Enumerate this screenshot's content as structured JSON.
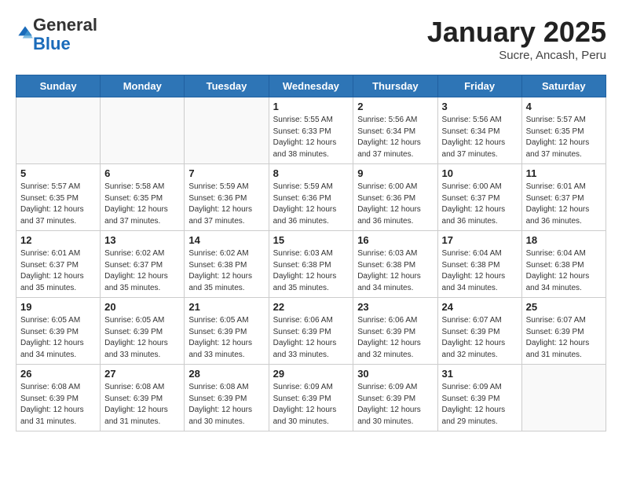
{
  "header": {
    "logo_general": "General",
    "logo_blue": "Blue",
    "month_title": "January 2025",
    "subtitle": "Sucre, Ancash, Peru"
  },
  "days_of_week": [
    "Sunday",
    "Monday",
    "Tuesday",
    "Wednesday",
    "Thursday",
    "Friday",
    "Saturday"
  ],
  "weeks": [
    [
      {
        "day": "",
        "info": ""
      },
      {
        "day": "",
        "info": ""
      },
      {
        "day": "",
        "info": ""
      },
      {
        "day": "1",
        "info": "Sunrise: 5:55 AM\nSunset: 6:33 PM\nDaylight: 12 hours\nand 38 minutes."
      },
      {
        "day": "2",
        "info": "Sunrise: 5:56 AM\nSunset: 6:34 PM\nDaylight: 12 hours\nand 37 minutes."
      },
      {
        "day": "3",
        "info": "Sunrise: 5:56 AM\nSunset: 6:34 PM\nDaylight: 12 hours\nand 37 minutes."
      },
      {
        "day": "4",
        "info": "Sunrise: 5:57 AM\nSunset: 6:35 PM\nDaylight: 12 hours\nand 37 minutes."
      }
    ],
    [
      {
        "day": "5",
        "info": "Sunrise: 5:57 AM\nSunset: 6:35 PM\nDaylight: 12 hours\nand 37 minutes."
      },
      {
        "day": "6",
        "info": "Sunrise: 5:58 AM\nSunset: 6:35 PM\nDaylight: 12 hours\nand 37 minutes."
      },
      {
        "day": "7",
        "info": "Sunrise: 5:59 AM\nSunset: 6:36 PM\nDaylight: 12 hours\nand 37 minutes."
      },
      {
        "day": "8",
        "info": "Sunrise: 5:59 AM\nSunset: 6:36 PM\nDaylight: 12 hours\nand 36 minutes."
      },
      {
        "day": "9",
        "info": "Sunrise: 6:00 AM\nSunset: 6:36 PM\nDaylight: 12 hours\nand 36 minutes."
      },
      {
        "day": "10",
        "info": "Sunrise: 6:00 AM\nSunset: 6:37 PM\nDaylight: 12 hours\nand 36 minutes."
      },
      {
        "day": "11",
        "info": "Sunrise: 6:01 AM\nSunset: 6:37 PM\nDaylight: 12 hours\nand 36 minutes."
      }
    ],
    [
      {
        "day": "12",
        "info": "Sunrise: 6:01 AM\nSunset: 6:37 PM\nDaylight: 12 hours\nand 35 minutes."
      },
      {
        "day": "13",
        "info": "Sunrise: 6:02 AM\nSunset: 6:37 PM\nDaylight: 12 hours\nand 35 minutes."
      },
      {
        "day": "14",
        "info": "Sunrise: 6:02 AM\nSunset: 6:38 PM\nDaylight: 12 hours\nand 35 minutes."
      },
      {
        "day": "15",
        "info": "Sunrise: 6:03 AM\nSunset: 6:38 PM\nDaylight: 12 hours\nand 35 minutes."
      },
      {
        "day": "16",
        "info": "Sunrise: 6:03 AM\nSunset: 6:38 PM\nDaylight: 12 hours\nand 34 minutes."
      },
      {
        "day": "17",
        "info": "Sunrise: 6:04 AM\nSunset: 6:38 PM\nDaylight: 12 hours\nand 34 minutes."
      },
      {
        "day": "18",
        "info": "Sunrise: 6:04 AM\nSunset: 6:38 PM\nDaylight: 12 hours\nand 34 minutes."
      }
    ],
    [
      {
        "day": "19",
        "info": "Sunrise: 6:05 AM\nSunset: 6:39 PM\nDaylight: 12 hours\nand 34 minutes."
      },
      {
        "day": "20",
        "info": "Sunrise: 6:05 AM\nSunset: 6:39 PM\nDaylight: 12 hours\nand 33 minutes."
      },
      {
        "day": "21",
        "info": "Sunrise: 6:05 AM\nSunset: 6:39 PM\nDaylight: 12 hours\nand 33 minutes."
      },
      {
        "day": "22",
        "info": "Sunrise: 6:06 AM\nSunset: 6:39 PM\nDaylight: 12 hours\nand 33 minutes."
      },
      {
        "day": "23",
        "info": "Sunrise: 6:06 AM\nSunset: 6:39 PM\nDaylight: 12 hours\nand 32 minutes."
      },
      {
        "day": "24",
        "info": "Sunrise: 6:07 AM\nSunset: 6:39 PM\nDaylight: 12 hours\nand 32 minutes."
      },
      {
        "day": "25",
        "info": "Sunrise: 6:07 AM\nSunset: 6:39 PM\nDaylight: 12 hours\nand 31 minutes."
      }
    ],
    [
      {
        "day": "26",
        "info": "Sunrise: 6:08 AM\nSunset: 6:39 PM\nDaylight: 12 hours\nand 31 minutes."
      },
      {
        "day": "27",
        "info": "Sunrise: 6:08 AM\nSunset: 6:39 PM\nDaylight: 12 hours\nand 31 minutes."
      },
      {
        "day": "28",
        "info": "Sunrise: 6:08 AM\nSunset: 6:39 PM\nDaylight: 12 hours\nand 30 minutes."
      },
      {
        "day": "29",
        "info": "Sunrise: 6:09 AM\nSunset: 6:39 PM\nDaylight: 12 hours\nand 30 minutes."
      },
      {
        "day": "30",
        "info": "Sunrise: 6:09 AM\nSunset: 6:39 PM\nDaylight: 12 hours\nand 30 minutes."
      },
      {
        "day": "31",
        "info": "Sunrise: 6:09 AM\nSunset: 6:39 PM\nDaylight: 12 hours\nand 29 minutes."
      },
      {
        "day": "",
        "info": ""
      }
    ]
  ]
}
